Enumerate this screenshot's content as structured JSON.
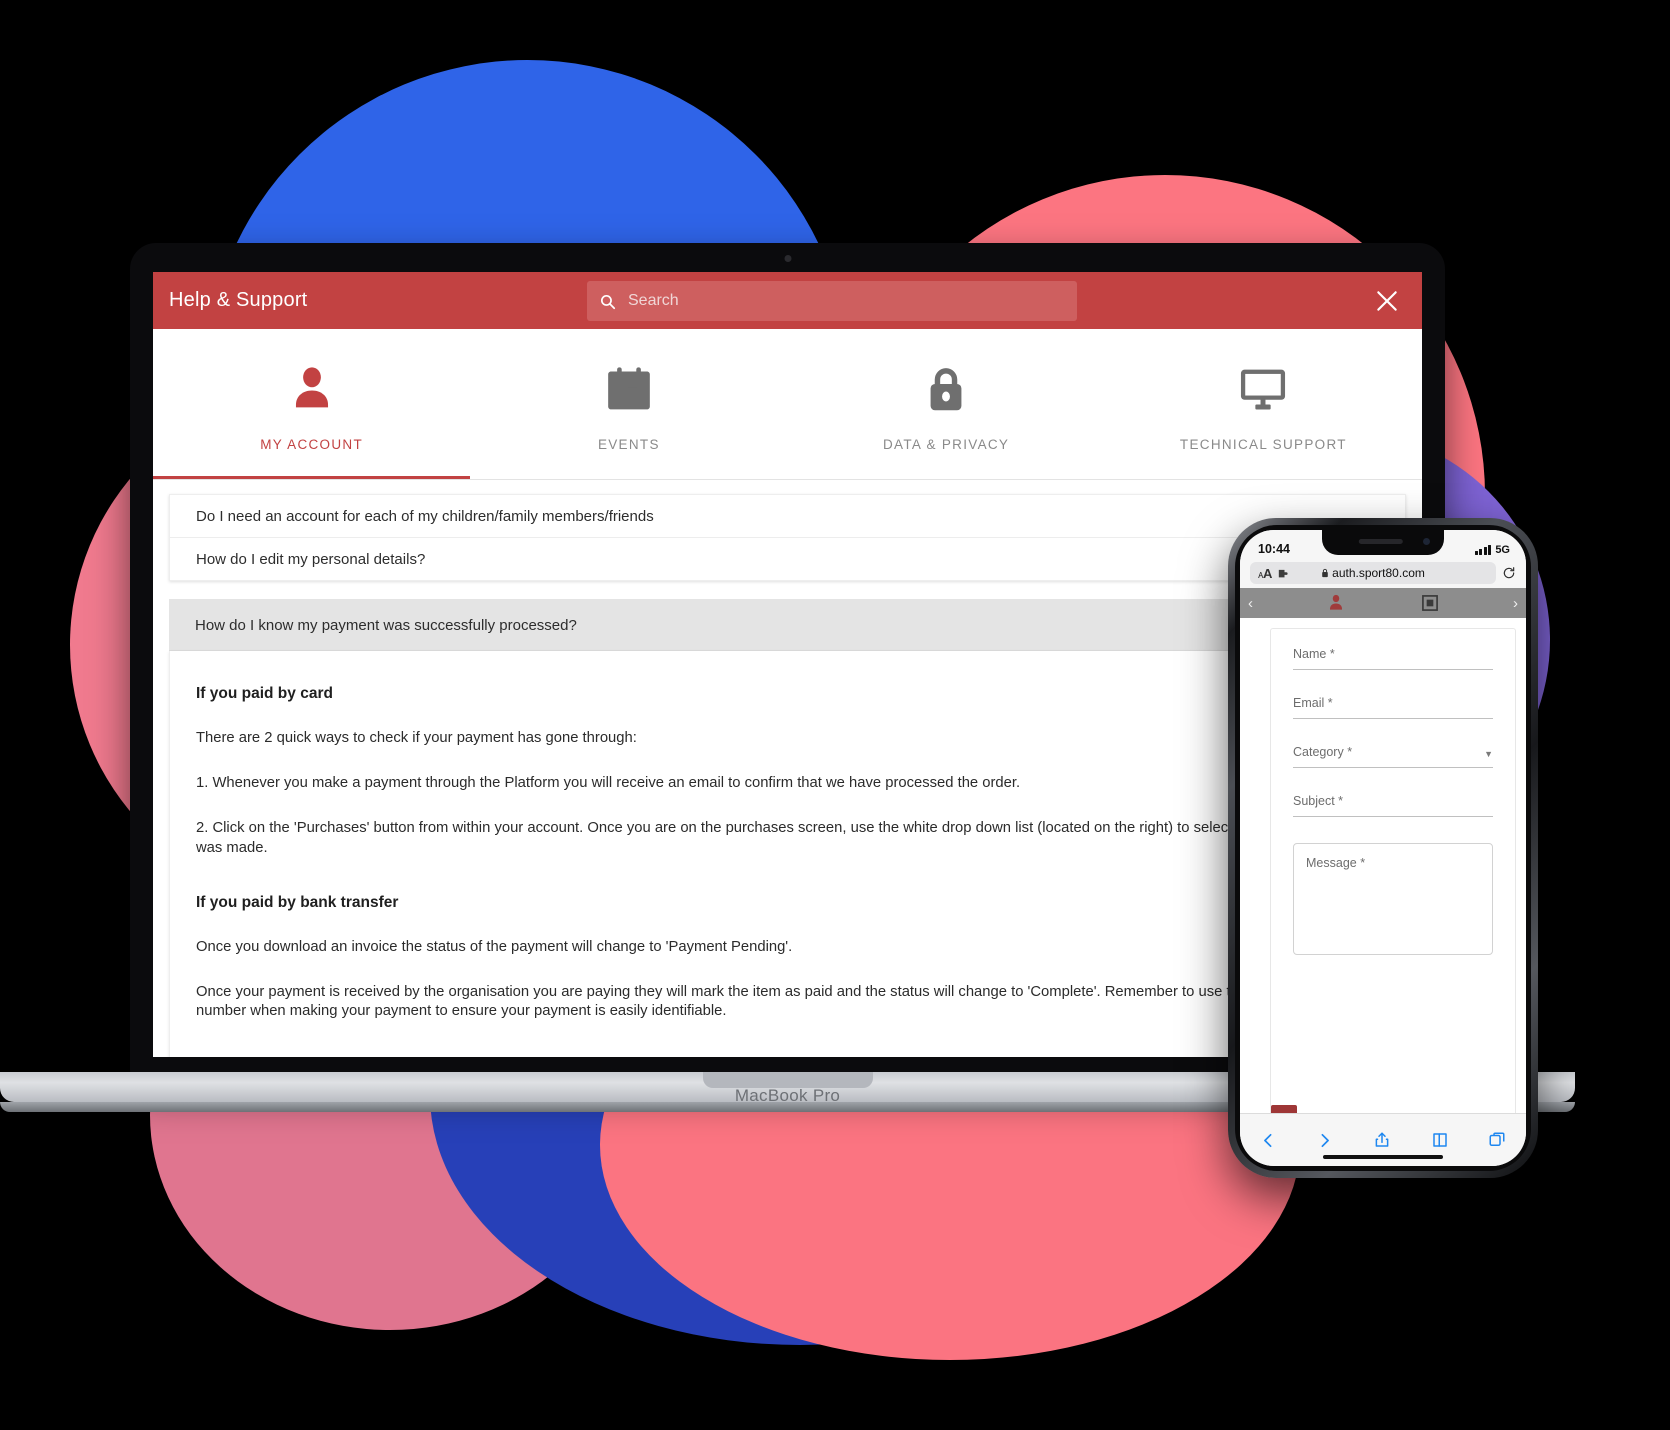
{
  "app": {
    "title": "Help & Support",
    "search_placeholder": "Search",
    "search_value": "",
    "close_label": "Close",
    "accent_color": "#c24242",
    "header_color": "#c24242"
  },
  "tabs": [
    {
      "label": "MY ACCOUNT",
      "icon": "person-icon",
      "active": true
    },
    {
      "label": "EVENTS",
      "icon": "calendar-icon",
      "active": false
    },
    {
      "label": "DATA & PRIVACY",
      "icon": "lock-icon",
      "active": false
    },
    {
      "label": "TECHNICAL SUPPORT",
      "icon": "monitor-icon",
      "active": false
    }
  ],
  "faq": {
    "collapsed": [
      "Do I need an account for each of my children/family members/friends",
      "How do I edit my personal details?"
    ],
    "expanded_question": "How do I know my payment was successfully processed?",
    "body": {
      "heading_card": "If you paid by card",
      "intro": "There are 2 quick ways to check if your payment has gone through:",
      "step_1": "1. Whenever you make a payment through the Platform you will receive an email to confirm that we have processed the order.",
      "step_2": "2. Click on the 'Purchases' button from within your account. Once you are on the purchases screen, use the white drop down list (located on the right) to select the date the payment was made.",
      "heading_bank": "If you paid by bank transfer",
      "bank_1": "Once you download an invoice the status of the payment will change to 'Payment Pending'.",
      "bank_2": "Once your payment is received by the organisation you are paying they will mark the item as paid and the status will change to 'Complete'. Remember to use the relevant reference number when making your payment to ensure your payment is easily identifiable."
    }
  },
  "laptop": {
    "model_label": "MacBook Pro"
  },
  "phone": {
    "status": {
      "time": "10:44",
      "network": "5G"
    },
    "browser": {
      "text_size_label": "AA",
      "host": "auth.sport80.com",
      "reload_icon": "reload-icon",
      "lock_icon": "lock-icon",
      "puzzle_icon": "extensions-icon"
    },
    "form": {
      "fields": [
        {
          "label": "Name *",
          "type": "text",
          "value": ""
        },
        {
          "label": "Email *",
          "type": "text",
          "value": ""
        },
        {
          "label": "Category *",
          "type": "select",
          "value": ""
        },
        {
          "label": "Subject *",
          "type": "text",
          "value": ""
        }
      ],
      "message_label": "Message *",
      "message_value": ""
    },
    "toolbar": {
      "back": "back-icon",
      "forward": "forward-icon",
      "share": "share-icon",
      "bookmarks": "bookmarks-icon",
      "tabs": "tabs-icon"
    }
  }
}
